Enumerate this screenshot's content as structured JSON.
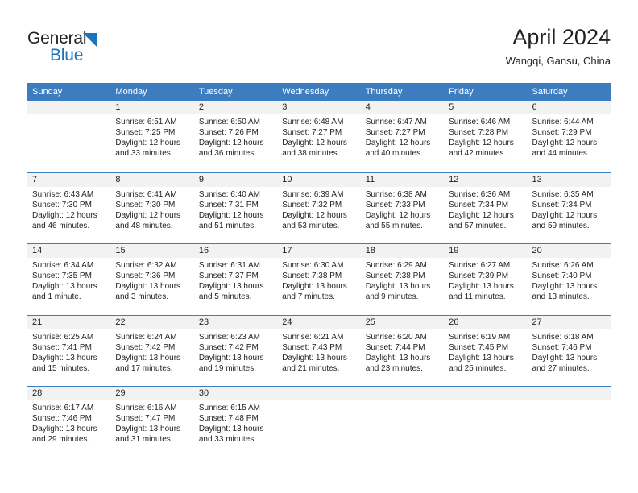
{
  "logo": {
    "word_one": "General",
    "word_two": "Blue"
  },
  "header": {
    "title": "April 2024",
    "subtitle": "Wangqi, Gansu, China"
  },
  "colors": {
    "header_blue": "#3c7cbf",
    "logo_blue": "#1b75bb",
    "day_number_band": "#f2f2f2",
    "text": "#231f20"
  },
  "weekdays": [
    "Sunday",
    "Monday",
    "Tuesday",
    "Wednesday",
    "Thursday",
    "Friday",
    "Saturday"
  ],
  "weeks": [
    [
      {
        "day": "",
        "lines": []
      },
      {
        "day": "1",
        "lines": [
          "Sunrise: 6:51 AM",
          "Sunset: 7:25 PM",
          "Daylight: 12 hours",
          "and 33 minutes."
        ]
      },
      {
        "day": "2",
        "lines": [
          "Sunrise: 6:50 AM",
          "Sunset: 7:26 PM",
          "Daylight: 12 hours",
          "and 36 minutes."
        ]
      },
      {
        "day": "3",
        "lines": [
          "Sunrise: 6:48 AM",
          "Sunset: 7:27 PM",
          "Daylight: 12 hours",
          "and 38 minutes."
        ]
      },
      {
        "day": "4",
        "lines": [
          "Sunrise: 6:47 AM",
          "Sunset: 7:27 PM",
          "Daylight: 12 hours",
          "and 40 minutes."
        ]
      },
      {
        "day": "5",
        "lines": [
          "Sunrise: 6:46 AM",
          "Sunset: 7:28 PM",
          "Daylight: 12 hours",
          "and 42 minutes."
        ]
      },
      {
        "day": "6",
        "lines": [
          "Sunrise: 6:44 AM",
          "Sunset: 7:29 PM",
          "Daylight: 12 hours",
          "and 44 minutes."
        ]
      }
    ],
    [
      {
        "day": "7",
        "lines": [
          "Sunrise: 6:43 AM",
          "Sunset: 7:30 PM",
          "Daylight: 12 hours",
          "and 46 minutes."
        ]
      },
      {
        "day": "8",
        "lines": [
          "Sunrise: 6:41 AM",
          "Sunset: 7:30 PM",
          "Daylight: 12 hours",
          "and 48 minutes."
        ]
      },
      {
        "day": "9",
        "lines": [
          "Sunrise: 6:40 AM",
          "Sunset: 7:31 PM",
          "Daylight: 12 hours",
          "and 51 minutes."
        ]
      },
      {
        "day": "10",
        "lines": [
          "Sunrise: 6:39 AM",
          "Sunset: 7:32 PM",
          "Daylight: 12 hours",
          "and 53 minutes."
        ]
      },
      {
        "day": "11",
        "lines": [
          "Sunrise: 6:38 AM",
          "Sunset: 7:33 PM",
          "Daylight: 12 hours",
          "and 55 minutes."
        ]
      },
      {
        "day": "12",
        "lines": [
          "Sunrise: 6:36 AM",
          "Sunset: 7:34 PM",
          "Daylight: 12 hours",
          "and 57 minutes."
        ]
      },
      {
        "day": "13",
        "lines": [
          "Sunrise: 6:35 AM",
          "Sunset: 7:34 PM",
          "Daylight: 12 hours",
          "and 59 minutes."
        ]
      }
    ],
    [
      {
        "day": "14",
        "lines": [
          "Sunrise: 6:34 AM",
          "Sunset: 7:35 PM",
          "Daylight: 13 hours",
          "and 1 minute."
        ]
      },
      {
        "day": "15",
        "lines": [
          "Sunrise: 6:32 AM",
          "Sunset: 7:36 PM",
          "Daylight: 13 hours",
          "and 3 minutes."
        ]
      },
      {
        "day": "16",
        "lines": [
          "Sunrise: 6:31 AM",
          "Sunset: 7:37 PM",
          "Daylight: 13 hours",
          "and 5 minutes."
        ]
      },
      {
        "day": "17",
        "lines": [
          "Sunrise: 6:30 AM",
          "Sunset: 7:38 PM",
          "Daylight: 13 hours",
          "and 7 minutes."
        ]
      },
      {
        "day": "18",
        "lines": [
          "Sunrise: 6:29 AM",
          "Sunset: 7:38 PM",
          "Daylight: 13 hours",
          "and 9 minutes."
        ]
      },
      {
        "day": "19",
        "lines": [
          "Sunrise: 6:27 AM",
          "Sunset: 7:39 PM",
          "Daylight: 13 hours",
          "and 11 minutes."
        ]
      },
      {
        "day": "20",
        "lines": [
          "Sunrise: 6:26 AM",
          "Sunset: 7:40 PM",
          "Daylight: 13 hours",
          "and 13 minutes."
        ]
      }
    ],
    [
      {
        "day": "21",
        "lines": [
          "Sunrise: 6:25 AM",
          "Sunset: 7:41 PM",
          "Daylight: 13 hours",
          "and 15 minutes."
        ]
      },
      {
        "day": "22",
        "lines": [
          "Sunrise: 6:24 AM",
          "Sunset: 7:42 PM",
          "Daylight: 13 hours",
          "and 17 minutes."
        ]
      },
      {
        "day": "23",
        "lines": [
          "Sunrise: 6:23 AM",
          "Sunset: 7:42 PM",
          "Daylight: 13 hours",
          "and 19 minutes."
        ]
      },
      {
        "day": "24",
        "lines": [
          "Sunrise: 6:21 AM",
          "Sunset: 7:43 PM",
          "Daylight: 13 hours",
          "and 21 minutes."
        ]
      },
      {
        "day": "25",
        "lines": [
          "Sunrise: 6:20 AM",
          "Sunset: 7:44 PM",
          "Daylight: 13 hours",
          "and 23 minutes."
        ]
      },
      {
        "day": "26",
        "lines": [
          "Sunrise: 6:19 AM",
          "Sunset: 7:45 PM",
          "Daylight: 13 hours",
          "and 25 minutes."
        ]
      },
      {
        "day": "27",
        "lines": [
          "Sunrise: 6:18 AM",
          "Sunset: 7:46 PM",
          "Daylight: 13 hours",
          "and 27 minutes."
        ]
      }
    ],
    [
      {
        "day": "28",
        "lines": [
          "Sunrise: 6:17 AM",
          "Sunset: 7:46 PM",
          "Daylight: 13 hours",
          "and 29 minutes."
        ]
      },
      {
        "day": "29",
        "lines": [
          "Sunrise: 6:16 AM",
          "Sunset: 7:47 PM",
          "Daylight: 13 hours",
          "and 31 minutes."
        ]
      },
      {
        "day": "30",
        "lines": [
          "Sunrise: 6:15 AM",
          "Sunset: 7:48 PM",
          "Daylight: 13 hours",
          "and 33 minutes."
        ]
      },
      {
        "day": "",
        "lines": []
      },
      {
        "day": "",
        "lines": []
      },
      {
        "day": "",
        "lines": []
      },
      {
        "day": "",
        "lines": []
      }
    ]
  ]
}
